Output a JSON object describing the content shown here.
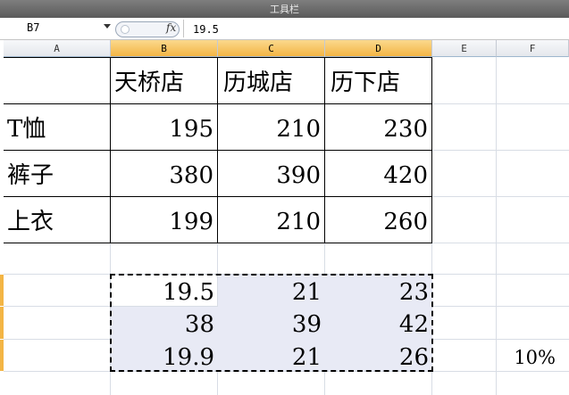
{
  "window": {
    "title": "工具栏"
  },
  "formula_bar": {
    "name_box": "B7",
    "fx_label": "fx",
    "value": "19.5"
  },
  "columns": [
    "A",
    "B",
    "C",
    "D",
    "E",
    "F"
  ],
  "table": {
    "headers": [
      "天桥店",
      "历城店",
      "历下店"
    ],
    "rows": [
      {
        "label": "T恤",
        "values": [
          "195",
          "210",
          "230"
        ]
      },
      {
        "label": "裤子",
        "values": [
          "380",
          "390",
          "420"
        ]
      },
      {
        "label": "上衣",
        "values": [
          "199",
          "210",
          "260"
        ]
      }
    ]
  },
  "selection": {
    "rows": [
      [
        "19.5",
        "21",
        "23"
      ],
      [
        "38",
        "39",
        "42"
      ],
      [
        "19.9",
        "21",
        "26"
      ]
    ]
  },
  "f_cell": "10%",
  "colors": {
    "selected_header": "#f3b545",
    "selection_fill": "#e8eaf5",
    "row_marker": "#f3b545"
  }
}
